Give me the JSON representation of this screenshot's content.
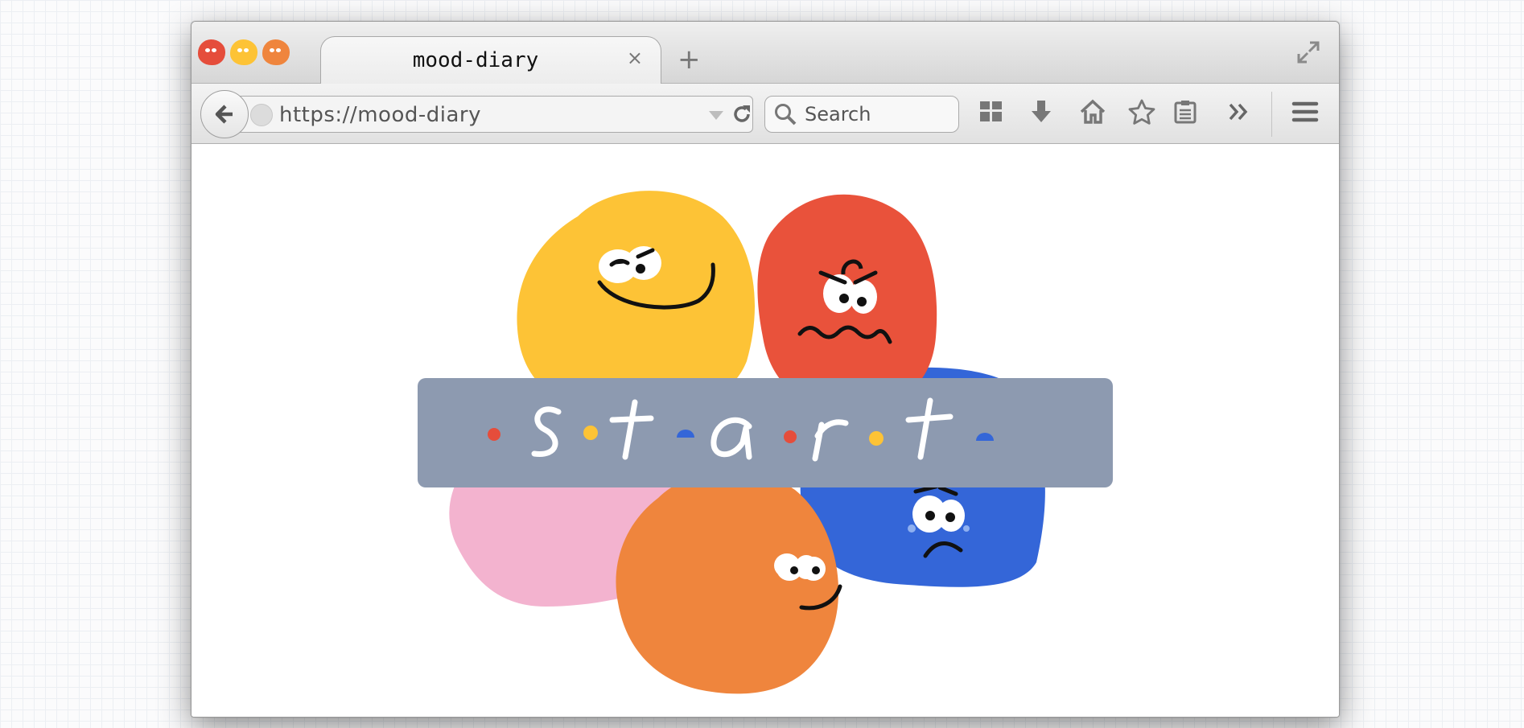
{
  "browser": {
    "tab": {
      "title": "mood-diary",
      "close_glyph": "×"
    },
    "new_tab_glyph": "+",
    "url": {
      "scheme": "https://",
      "host": "mood-diary"
    },
    "search": {
      "placeholder": "Search"
    },
    "toolbar_icons": [
      "back-arrow-icon",
      "globe-icon",
      "dropdown-icon",
      "reload-icon",
      "search-icon",
      "grid-icon",
      "download-icon",
      "home-icon",
      "star-icon",
      "reader-icon",
      "overflow-chevrons-icon",
      "menu-icon",
      "fullscreen-icon"
    ]
  },
  "page": {
    "start_word": [
      "s",
      "t",
      "a",
      "r",
      "t"
    ],
    "moods": [
      {
        "name": "happy",
        "color": "#fdc336"
      },
      {
        "name": "angry",
        "color": "#e9523b"
      },
      {
        "name": "love",
        "color": "#f3b3cf"
      },
      {
        "name": "calm",
        "color": "#ef853d"
      },
      {
        "name": "sad",
        "color": "#3466d8"
      }
    ],
    "bar_color": "#8d9ab0"
  }
}
